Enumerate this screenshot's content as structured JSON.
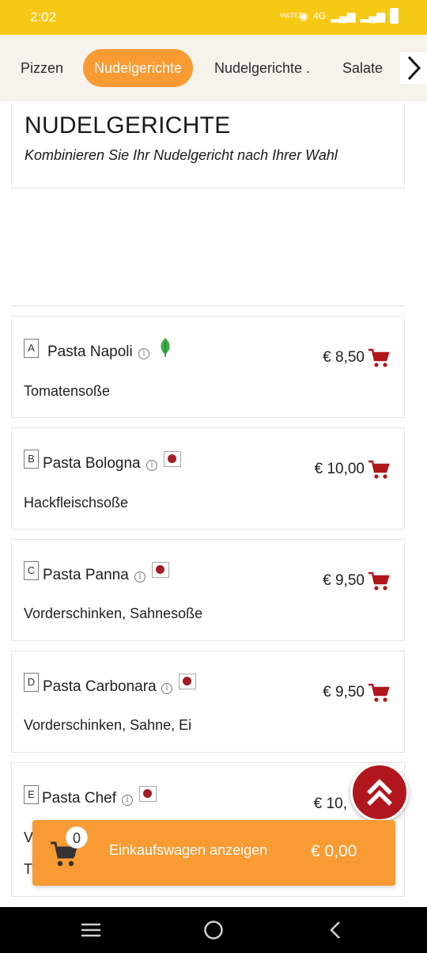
{
  "status_bar": {
    "time": "2:02",
    "volte": "VoLTE2",
    "network": "4G",
    "wifi_icon": "wifi-icon",
    "signal_icon": "signal-icon",
    "battery_icon": "battery-icon"
  },
  "tabs": [
    {
      "label": "Pizzen",
      "active": false
    },
    {
      "label": "Nudelgerichte",
      "active": true
    },
    {
      "label": "Nudelgerichte .",
      "active": false
    },
    {
      "label": "Salate",
      "active": false
    }
  ],
  "tabs_next_icon": "chevron-right-icon",
  "section": {
    "title": "NUDELGERICHTE",
    "subtitle": "Kombinieren Sie Ihr Nudelgericht nach Ihrer Wahl"
  },
  "items": [
    {
      "letter": "A",
      "name": "Pasta Napoli",
      "badge": "vegetarian-leaf",
      "price": "€ 8,50",
      "description": "Tomatensoße"
    },
    {
      "letter": "B",
      "name": "Pasta Bologna",
      "badge": "meat",
      "price": "€ 10,00",
      "description": "Hackfleischsoße"
    },
    {
      "letter": "C",
      "name": "Pasta Panna",
      "badge": "meat",
      "price": "€ 9,50",
      "description": "Vorderschinken, Sahnesoße"
    },
    {
      "letter": "D",
      "name": "Pasta Carbonara",
      "badge": "meat",
      "price": "€ 9,50",
      "description": "Vorderschinken, Sahne, Ei"
    },
    {
      "letter": "E",
      "name": "Pasta Chef",
      "badge": "meat",
      "price": "€ 10,",
      "description": "V",
      "description_2": "T"
    }
  ],
  "info_glyph": "i",
  "cart": {
    "count": "0",
    "label": "Einkaufswagen anzeigen",
    "total": "€ 0,00"
  },
  "colors": {
    "status_bar": "#f6c915",
    "accent_orange": "#f89b33",
    "cart_red": "#b0161c",
    "leaf_green": "#3fae49"
  }
}
